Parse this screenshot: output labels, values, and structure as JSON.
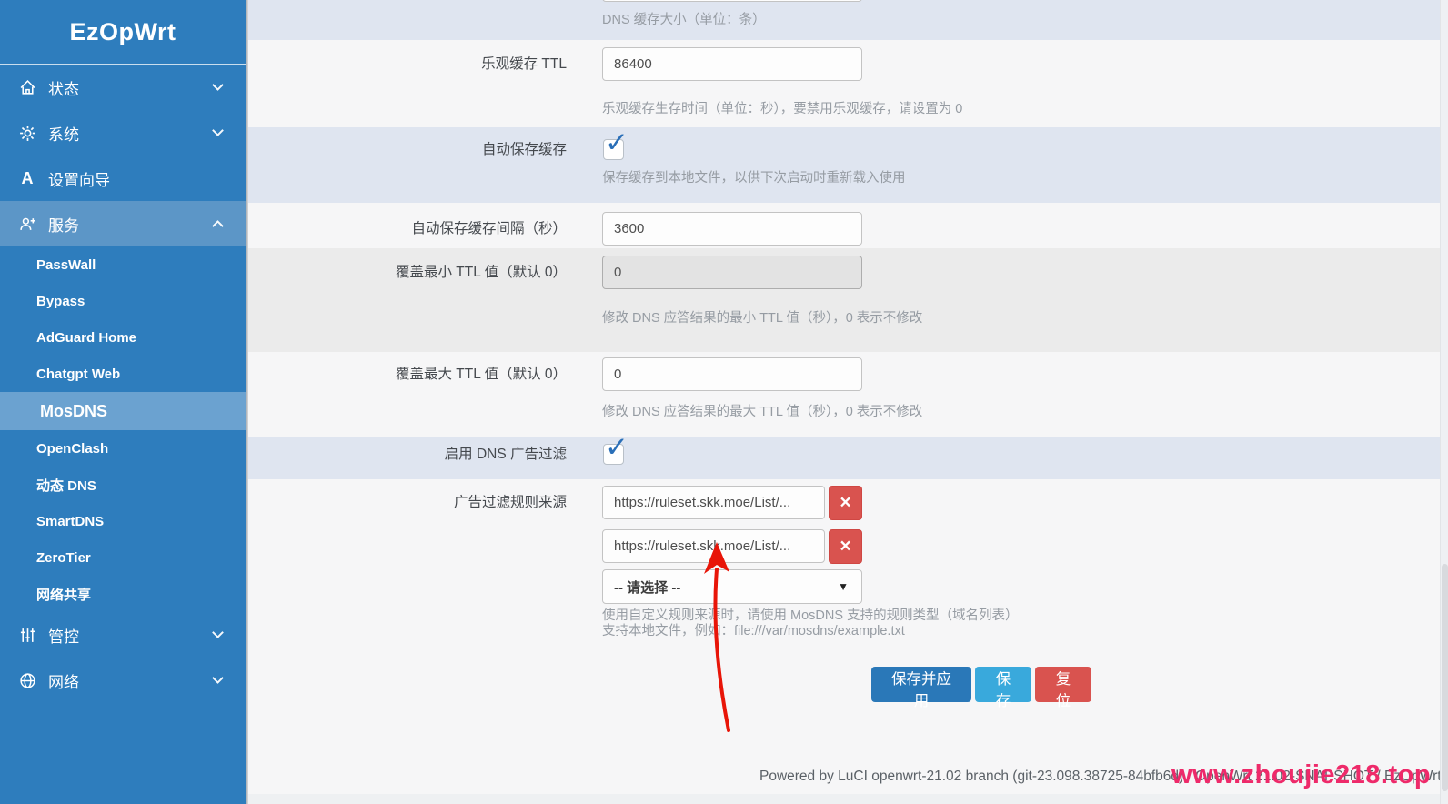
{
  "sidebar": {
    "title": "EzOpWrt",
    "items": [
      {
        "label": "状态",
        "icon": "home-icon",
        "chevron": "down"
      },
      {
        "label": "系统",
        "icon": "gear-icon",
        "chevron": "down"
      },
      {
        "label": "设置向导",
        "icon": "wizard-icon",
        "chevron": "none"
      },
      {
        "label": "服务",
        "icon": "services-icon",
        "chevron": "up",
        "expanded": true
      },
      {
        "label": "管控",
        "icon": "sliders-icon",
        "chevron": "down"
      },
      {
        "label": "网络",
        "icon": "globe-icon",
        "chevron": "down"
      }
    ],
    "services_submenu": [
      "PassWall",
      "Bypass",
      "AdGuard Home",
      "Chatgpt Web",
      "MosDNS",
      "OpenClash",
      "动态 DNS",
      "SmartDNS",
      "ZeroTier",
      "网络共享"
    ],
    "selected_item": "MosDNS"
  },
  "form": {
    "dns_cache_size": {
      "description": "DNS 缓存大小（单位：条）"
    },
    "optimistic_ttl": {
      "label": "乐观缓存 TTL",
      "value": "86400",
      "description": "乐观缓存生存时间（单位：秒），要禁用乐观缓存，请设置为 0"
    },
    "auto_save_cache": {
      "label": "自动保存缓存",
      "checked": true,
      "description": "保存缓存到本地文件，以供下次启动时重新载入使用"
    },
    "auto_save_interval": {
      "label": "自动保存缓存间隔（秒）",
      "value": "3600"
    },
    "min_ttl": {
      "label": "覆盖最小 TTL 值（默认 0）",
      "value": "0",
      "disabled": true,
      "description": "修改 DNS 应答结果的最小 TTL 值（秒），0 表示不修改"
    },
    "max_ttl": {
      "label": "覆盖最大 TTL 值（默认 0）",
      "value": "0",
      "description": "修改 DNS 应答结果的最大 TTL 值（秒），0 表示不修改"
    },
    "adblock_enable": {
      "label": "启用 DNS 广告过滤",
      "checked": true
    },
    "adblock_sources": {
      "label": "广告过滤规则来源",
      "values": [
        "https://ruleset.skk.moe/List/...",
        "https://ruleset.skk.moe/List/..."
      ],
      "select_placeholder": "-- 请选择 --",
      "description_line1": "使用自定义规则来源时，请使用 MosDNS 支持的规则类型（域名列表）",
      "description_line2": "支持本地文件，例如：file:///var/mosdns/example.txt"
    }
  },
  "actions": {
    "save_apply": "保存并应用",
    "save": "保存",
    "reset": "复位",
    "remove": "×"
  },
  "icons": {
    "check": "✓",
    "select_arrow": "▼"
  },
  "footer": {
    "powered_by": "Powered by LuCI openwrt-21.02 branch (git-23.098.38725-84bfb6d) / OpenWrt 21.02-SNAPSHOT / EzOpWrt",
    "watermark": "www.zhoujie218.top"
  },
  "colors": {
    "sidebar_bg": "#2e7dbd",
    "sidebar_expanded": "#5c96c7",
    "sidebar_selected": "#6ba2d0",
    "band_blue": "#dfe5f0",
    "band_gray": "#ebebeb",
    "btn_save_apply": "#2a78b8",
    "btn_save": "#39a9dc",
    "btn_reset": "#d9534f",
    "remove_btn": "#d9534f",
    "checkmark": "#2a6fb8",
    "watermark": "#ee2a6a",
    "annotation_arrow": "#e81508"
  }
}
